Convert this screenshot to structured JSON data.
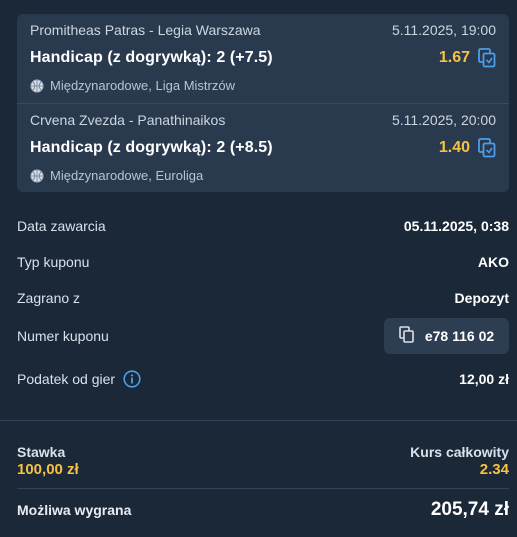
{
  "events": [
    {
      "teams": "Promitheas Patras - Legia Warszawa",
      "datetime": "5.11.2025, 19:00",
      "market": "Handicap (z dogrywką): 2 (+7.5)",
      "odds": "1.67",
      "league": "Międzynarodowe, Liga Mistrzów",
      "sport_icon": "basketball-icon",
      "odds_icon": "copy-odds-icon"
    },
    {
      "teams": "Crvena Zvezda - Panathinaikos",
      "datetime": "5.11.2025, 20:00",
      "market": "Handicap (z dogrywką): 2 (+8.5)",
      "odds": "1.40",
      "league": "Międzynarodowe, Euroliga",
      "sport_icon": "basketball-icon",
      "odds_icon": "copy-odds-icon"
    }
  ],
  "details": {
    "date_label": "Data zawarcia",
    "date_value": "05.11.2025, 0:38",
    "type_label": "Typ kuponu",
    "type_value": "AKO",
    "played_label": "Zagrano z",
    "played_value": "Depozyt",
    "ticket_label": "Numer kuponu",
    "ticket_value": "e78 116 02",
    "tax_label": "Podatek od gier",
    "tax_value": "12,00 zł"
  },
  "summary": {
    "stake_label": "Stawka",
    "stake_value": "100,00 zł",
    "total_odds_label": "Kurs całkowity",
    "total_odds_value": "2.34",
    "win_label": "Możliwa wygrana",
    "win_value": "205,74 zł"
  },
  "colors": {
    "background": "#1b2838",
    "card": "#2a3a4e",
    "accent_odds": "#f5c242",
    "icon_blue": "#4a9fe8"
  }
}
